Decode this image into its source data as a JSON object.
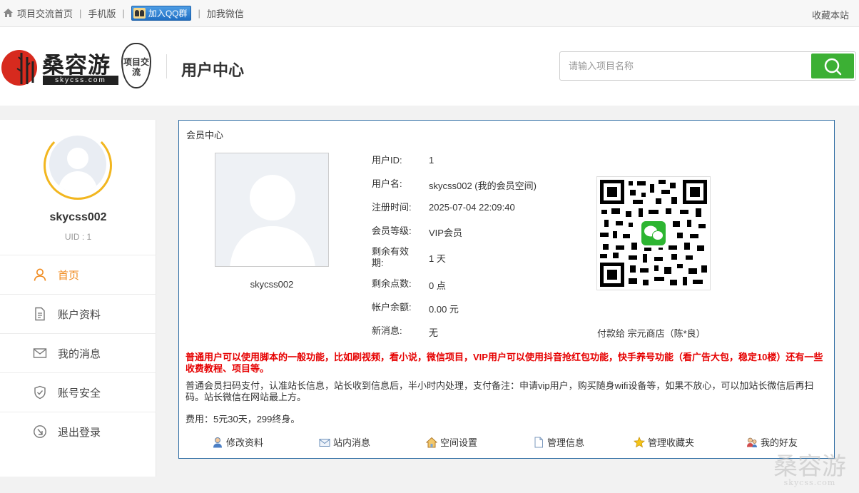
{
  "topbar": {
    "home": "项目交流首页",
    "mobile": "手机版",
    "qq_group": "加入QQ群",
    "wechat": "加我微信",
    "favorite": "收藏本站"
  },
  "header": {
    "brand": "桑容游",
    "brand_url": "skycss.com",
    "pear_text": "项目交流",
    "title": "用户中心",
    "search_placeholder": "请输入项目名称"
  },
  "sidebar": {
    "username": "skycss002",
    "uid": "UID : 1",
    "items": [
      {
        "label": "首页",
        "icon": "user-icon",
        "active": true
      },
      {
        "label": "账户资料",
        "icon": "document-icon",
        "active": false
      },
      {
        "label": "我的消息",
        "icon": "mail-icon",
        "active": false
      },
      {
        "label": "账号安全",
        "icon": "shield-icon",
        "active": false
      },
      {
        "label": "退出登录",
        "icon": "logout-icon",
        "active": false
      }
    ]
  },
  "panel": {
    "title": "会员中心",
    "photo_name": "skycss002",
    "fields": [
      {
        "key": "用户ID:",
        "value": "1"
      },
      {
        "key": "用户名:",
        "value": "skycss002   (我的会员空间)"
      },
      {
        "key": "注册时间:",
        "value": "2025-07-04 22:09:40"
      },
      {
        "key": "会员等级:",
        "value": "VIP会员"
      },
      {
        "key": "剩余有效期:",
        "value": "1 天"
      },
      {
        "key": "剩余点数:",
        "value": "0 点"
      },
      {
        "key": "帐户余额:",
        "value": "0.00 元"
      },
      {
        "key": "新消息:",
        "value": "无"
      }
    ],
    "qr_caption": "付款给 宗元商店（陈*良）",
    "notice_red": "普通用户可以使用脚本的一般功能，比如刷视频，看小说，微信项目，VIP用户可以使用抖音抢红包功能，快手养号功能（看广告大包，稳定10楼）还有一些收费教程、项目等。",
    "notice": "普通会员扫码支付，认准站长信息，站长收到信息后，半小时内处理，支付备注：申请vip用户，购买随身wifi设备等，如果不放心，可以加站长微信后再扫码。站长微信在网站最上方。",
    "fee": "费用：5元30天，299终身。",
    "actions": [
      {
        "label": "修改资料",
        "icon": "person-icon"
      },
      {
        "label": "站内消息",
        "icon": "envelope-icon"
      },
      {
        "label": "空间设置",
        "icon": "house-icon"
      },
      {
        "label": "管理信息",
        "icon": "page-icon"
      },
      {
        "label": "管理收藏夹",
        "icon": "star-icon"
      },
      {
        "label": "我的好友",
        "icon": "friends-icon"
      }
    ]
  },
  "watermark": {
    "text": "桑容游",
    "url": "skycss.com"
  },
  "colors": {
    "accent": "#f08a1d",
    "search_button": "#3cb034",
    "panel_border": "#2d6ca2",
    "notice_red": "#e60000",
    "ring": "#f2b61f"
  }
}
